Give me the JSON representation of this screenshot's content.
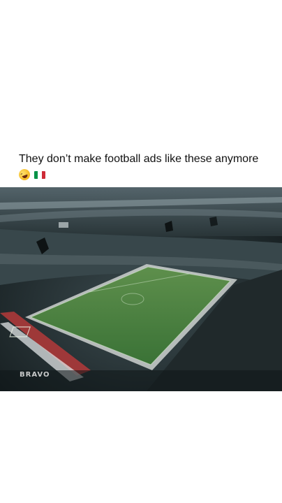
{
  "post": {
    "caption": "They don’t make football ads like these anymore",
    "emojis": [
      "rolling-on-floor-laughing-emoji",
      "italy-flag-emoji"
    ]
  },
  "video": {
    "watermark": "BRAVO"
  },
  "colors": {
    "background": "#ffffff",
    "caption_text": "#111111",
    "pitch": "#3f7f3a",
    "stands": "#2b3a3e",
    "flag_green": "#009246",
    "flag_white": "#ffffff",
    "flag_red": "#ce2b37"
  }
}
